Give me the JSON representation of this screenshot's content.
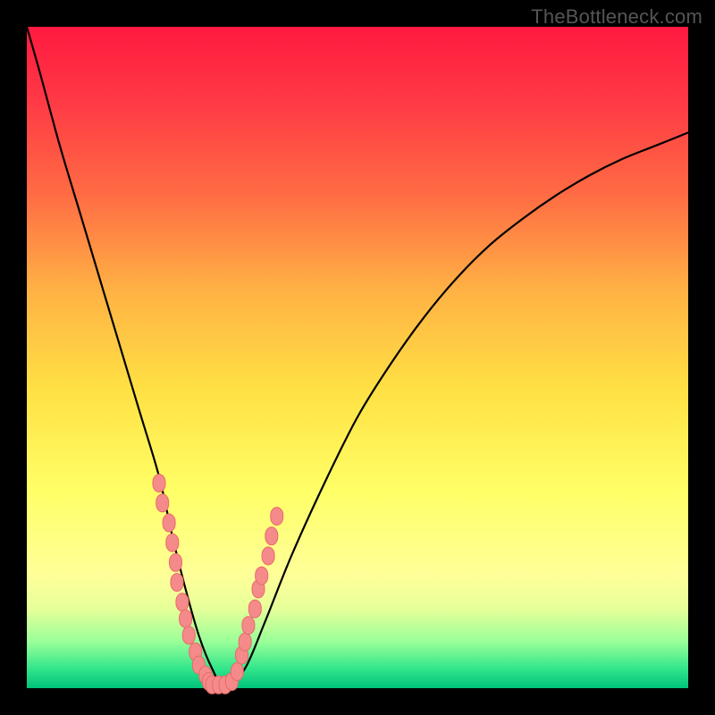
{
  "watermark": "TheBottleneck.com",
  "colors": {
    "frame": "#000000",
    "gradient_top": "#ff1a3f",
    "gradient_bottom": "#00c27a",
    "curve": "#000000",
    "markers_fill": "#f58a8a",
    "markers_stroke": "#e86a6a"
  },
  "chart_data": {
    "type": "line",
    "title": "",
    "xlabel": "",
    "ylabel": "",
    "xlim": [
      0,
      100
    ],
    "ylim": [
      0,
      100
    ],
    "series": [
      {
        "name": "bottleneck-curve",
        "x": [
          0,
          2,
          5,
          8,
          11,
          14,
          17,
          20,
          22,
          24,
          26,
          28,
          30,
          33,
          36,
          40,
          45,
          50,
          55,
          60,
          65,
          70,
          75,
          80,
          85,
          90,
          95,
          100
        ],
        "values": [
          100,
          93,
          82,
          72,
          62,
          52,
          42,
          32,
          23,
          15,
          8,
          3,
          0,
          3,
          10,
          20,
          31,
          41,
          49,
          56,
          62,
          67,
          71,
          74.5,
          77.5,
          80,
          82,
          84
        ]
      }
    ],
    "markers": {
      "name": "highlighted-points",
      "comment": "Pink rounded markers clustered near the curve minimum, mapped to same 0-100 axes.",
      "points": [
        {
          "x": 20.0,
          "y": 31
        },
        {
          "x": 20.5,
          "y": 28
        },
        {
          "x": 21.5,
          "y": 25
        },
        {
          "x": 22.0,
          "y": 22
        },
        {
          "x": 22.5,
          "y": 19
        },
        {
          "x": 22.7,
          "y": 16
        },
        {
          "x": 23.5,
          "y": 13
        },
        {
          "x": 24.0,
          "y": 10.5
        },
        {
          "x": 24.5,
          "y": 8
        },
        {
          "x": 25.5,
          "y": 5.5
        },
        {
          "x": 26.0,
          "y": 3.5
        },
        {
          "x": 27.0,
          "y": 2
        },
        {
          "x": 27.5,
          "y": 1
        },
        {
          "x": 28.0,
          "y": 0.5
        },
        {
          "x": 29.0,
          "y": 0.5
        },
        {
          "x": 30.0,
          "y": 0.5
        },
        {
          "x": 31.0,
          "y": 1
        },
        {
          "x": 31.8,
          "y": 2.5
        },
        {
          "x": 32.5,
          "y": 5
        },
        {
          "x": 33.0,
          "y": 7
        },
        {
          "x": 33.5,
          "y": 9.5
        },
        {
          "x": 34.5,
          "y": 12
        },
        {
          "x": 35.0,
          "y": 15
        },
        {
          "x": 35.5,
          "y": 17
        },
        {
          "x": 36.5,
          "y": 20
        },
        {
          "x": 37.0,
          "y": 23
        },
        {
          "x": 37.8,
          "y": 26
        }
      ]
    }
  }
}
